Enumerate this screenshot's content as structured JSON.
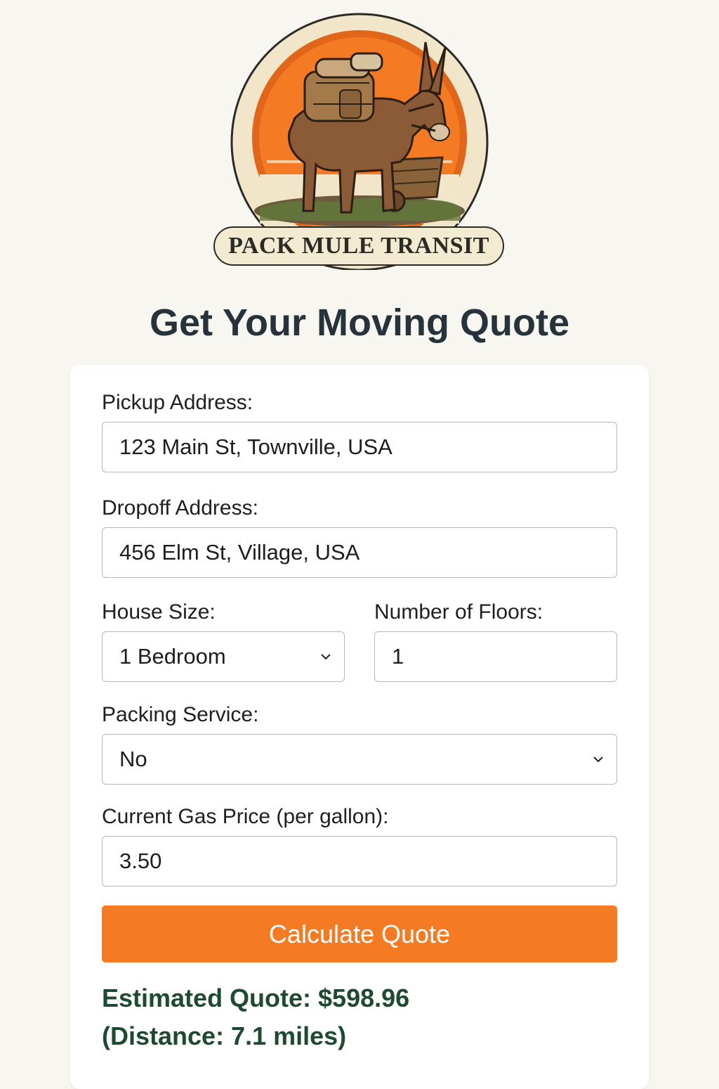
{
  "brand": {
    "name": "PACK MULE TRANSIT",
    "colors": {
      "orange": "#f47a23",
      "cream": "#f3ead2",
      "dark": "#2b2a24"
    }
  },
  "page": {
    "title": "Get Your Moving Quote"
  },
  "form": {
    "pickup": {
      "label": "Pickup Address:",
      "value": "123 Main St, Townville, USA"
    },
    "dropoff": {
      "label": "Dropoff Address:",
      "value": "456 Elm St, Village, USA"
    },
    "house_size": {
      "label": "House Size:",
      "value": "1 Bedroom",
      "icon": "chevron-down-icon"
    },
    "floors": {
      "label": "Number of Floors:",
      "value": "1"
    },
    "packing": {
      "label": "Packing Service:",
      "value": "No",
      "icon": "chevron-down-icon"
    },
    "gas_price": {
      "label": "Current Gas Price (per gallon):",
      "value": "3.50"
    },
    "submit_label": "Calculate Quote"
  },
  "result": {
    "quote_text": "Estimated Quote: $598.96",
    "distance_text": "(Distance: 7.1 miles)"
  }
}
